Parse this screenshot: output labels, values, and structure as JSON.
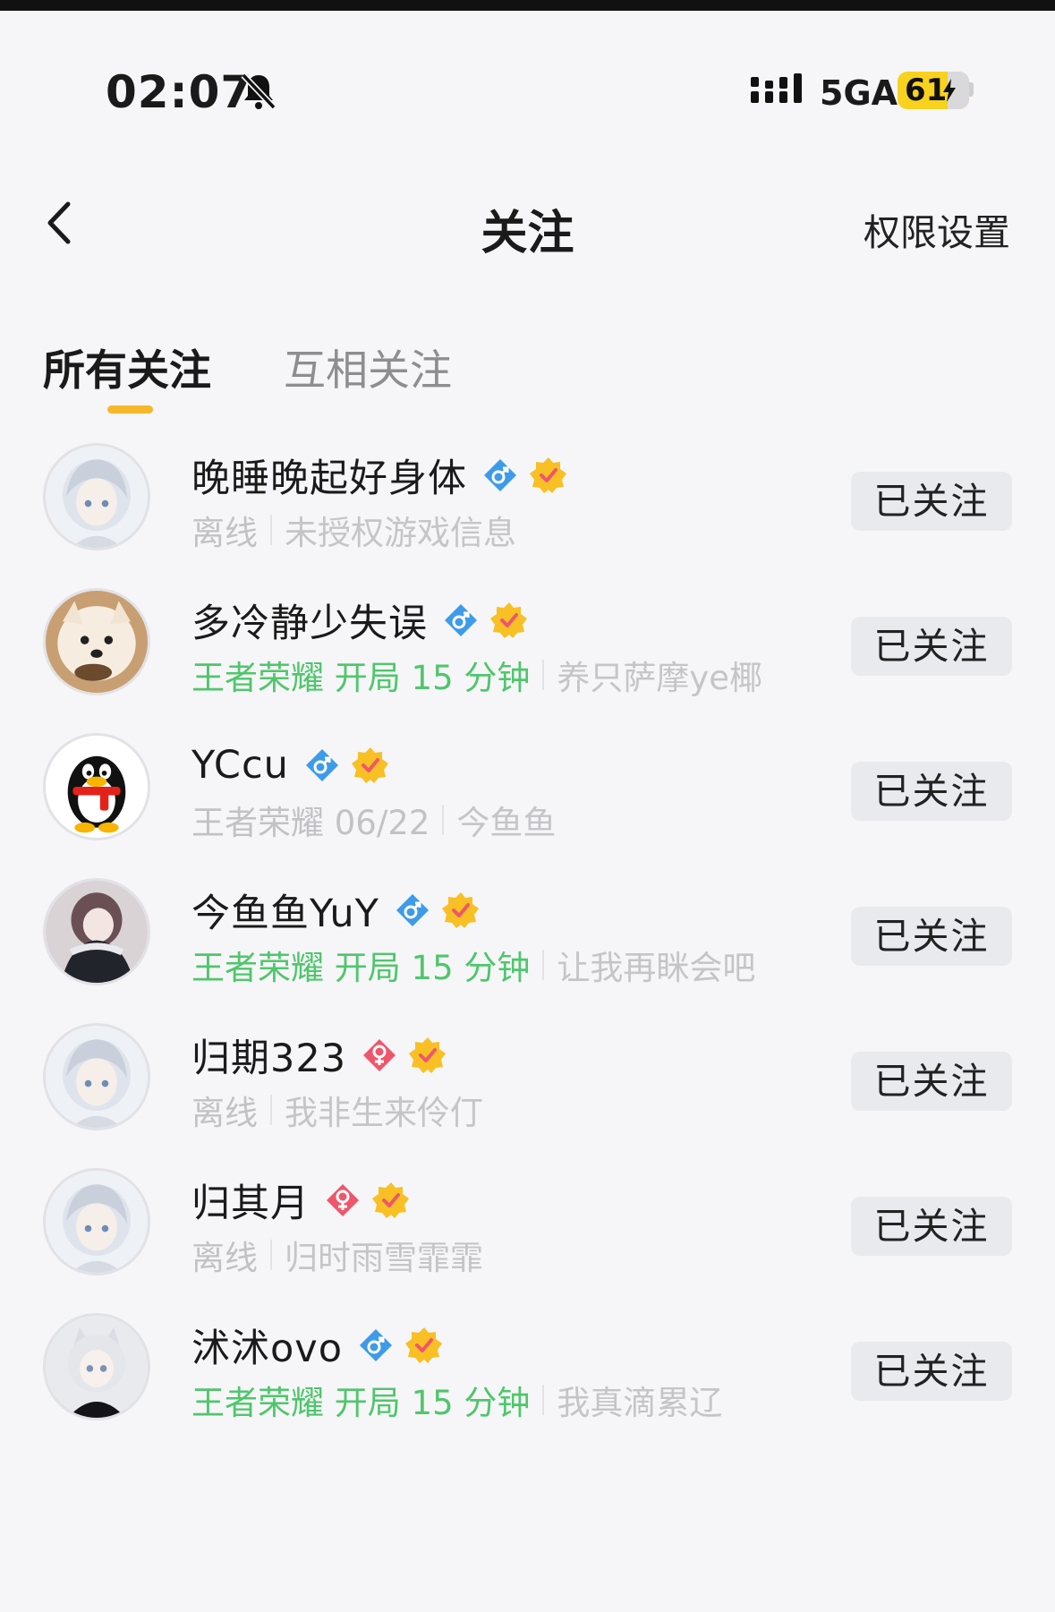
{
  "status_bar": {
    "time": "02:07",
    "network": "5GA",
    "battery": "61"
  },
  "nav": {
    "title": "关注",
    "permission_label": "权限设置"
  },
  "tabs": [
    {
      "label": "所有关注",
      "active": true
    },
    {
      "label": "互相关注",
      "active": false
    }
  ],
  "follow_button_label": "已关注",
  "users": [
    {
      "name": "晚睡晚起好身体",
      "gender": "male",
      "status": "离线",
      "playing": false,
      "signature": "未授权游戏信息",
      "avatar": "anime-white-hair"
    },
    {
      "name": "多冷静少失误",
      "gender": "male",
      "status": "王者荣耀 开局 15 分钟",
      "playing": true,
      "signature": "养只萨摩ye椰",
      "avatar": "samoyed-dog"
    },
    {
      "name": "YCcu",
      "gender": "male",
      "status": "王者荣耀 06/22",
      "playing": false,
      "signature": "今鱼鱼",
      "avatar": "qq-penguin"
    },
    {
      "name": "今鱼鱼YuY",
      "gender": "male",
      "status": "王者荣耀 开局 15 分钟",
      "playing": true,
      "signature": "让我再眯会吧",
      "avatar": "anime-dark-jacket"
    },
    {
      "name": "归期323",
      "gender": "female",
      "status": "离线",
      "playing": false,
      "signature": "我非生来伶仃",
      "avatar": "anime-white-hair"
    },
    {
      "name": "归其月",
      "gender": "female",
      "status": "离线",
      "playing": false,
      "signature": "归时雨雪霏霏",
      "avatar": "anime-white-hair"
    },
    {
      "name": "沭沭ovo",
      "gender": "male",
      "status": "王者荣耀 开局 15 分钟",
      "playing": true,
      "signature": "我真滴累辽",
      "avatar": "anime-cat-ears"
    }
  ],
  "colors": {
    "accent": "#f8b72a",
    "playing": "#4fc66c",
    "male": "#3d9be9",
    "female": "#f0566b",
    "crown": "#f8c025"
  }
}
